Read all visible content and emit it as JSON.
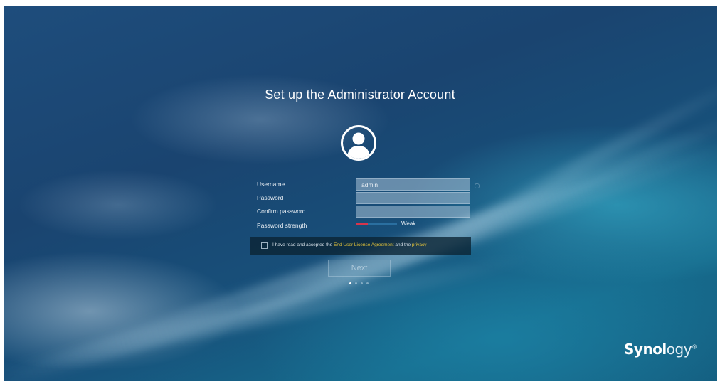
{
  "page": {
    "title": "Set up the Administrator Account"
  },
  "form": {
    "username_label": "Username",
    "username_value": "admin",
    "password_label": "Password",
    "password_value": "",
    "confirm_label": "Confirm password",
    "confirm_value": "",
    "strength_label": "Password strength",
    "strength_value": "Weak",
    "strength_level": 0.3
  },
  "agreement": {
    "text_before": "I have read and accepted the",
    "eula_link": "End User License Agreement",
    "text_middle": "and the",
    "privacy_link": "privacy"
  },
  "actions": {
    "next_label": "Next"
  },
  "steps": {
    "count": 4,
    "current": 1
  },
  "brand": {
    "logo_bold": "Synol",
    "logo_rest": "ogy",
    "logo_mark": "®"
  },
  "icons": {
    "avatar": "user-avatar-icon",
    "info": "info-icon"
  },
  "colors": {
    "strength_weak": "#d8344c",
    "link": "#e6c53a"
  }
}
